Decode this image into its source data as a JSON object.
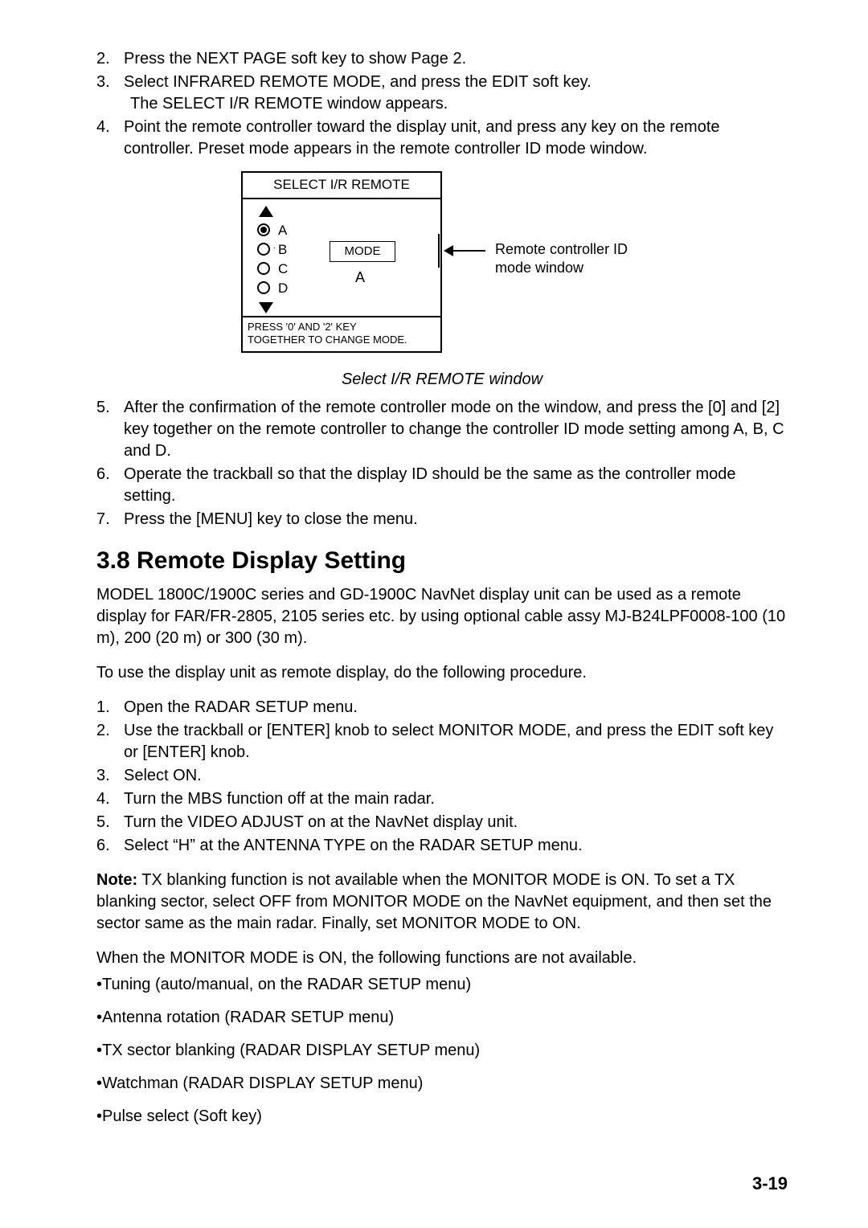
{
  "list1": {
    "i2": {
      "n": "2.",
      "t": "Press the NEXT PAGE soft key to show Page 2."
    },
    "i3": {
      "n": "3.",
      "t": "Select INFRARED REMOTE MODE, and press the EDIT soft key.",
      "sub": "The SELECT I/R REMOTE window appears."
    },
    "i4": {
      "n": "4.",
      "t": "Point the remote controller toward the display unit, and press any key on the remote controller. Preset mode appears in the remote controller ID mode window."
    }
  },
  "figure": {
    "title": "SELECT I/R REMOTE",
    "labels": {
      "A": "A",
      "B": "B",
      "C": "C",
      "D": "D"
    },
    "mode_label": "MODE",
    "mode_value": "A",
    "foot1": "PRESS '0' AND '2' KEY",
    "foot2": "TOGETHER TO CHANGE MODE.",
    "callout1": "Remote controller ID",
    "callout2": "mode window",
    "caption": "Select I/R REMOTE window"
  },
  "list2": {
    "i5": {
      "n": "5.",
      "t": "After the confirmation of the remote controller mode on the window, and press the [0] and [2] key together on the remote controller to change the controller ID mode setting among A, B, C and D."
    },
    "i6": {
      "n": "6.",
      "t": "Operate the trackball so that the display ID should be the same as the controller mode setting."
    },
    "i7": {
      "n": "7.",
      "t": "Press the [MENU] key to close the menu."
    }
  },
  "section_title": "3.8 Remote Display Setting",
  "para1": "MODEL 1800C/1900C series and GD-1900C NavNet display unit can be used as a remote display for FAR/FR-2805, 2105 series etc. by using optional cable assy MJ-B24LPF0008-100 (10 m), 200 (20 m) or 300 (30 m).",
  "para2": "To use the display unit as remote display, do the following procedure.",
  "list3": {
    "i1": {
      "n": "1.",
      "t": "Open the RADAR SETUP menu."
    },
    "i2": {
      "n": "2.",
      "t": "Use the trackball or [ENTER] knob to select MONITOR MODE, and press the EDIT soft key or [ENTER] knob."
    },
    "i3": {
      "n": "3.",
      "t": "Select ON."
    },
    "i4": {
      "n": "4.",
      "t": "Turn the MBS function off at the main radar."
    },
    "i5": {
      "n": "5.",
      "t": "Turn the VIDEO ADJUST on at the NavNet display unit."
    },
    "i6": {
      "n": "6.",
      "t": "Select “H” at the ANTENNA TYPE on the RADAR SETUP menu."
    }
  },
  "note_label": "Note:",
  "note_body": "    TX blanking function is not available when the MONITOR MODE is ON. To set a TX blanking sector, select OFF from MONITOR MODE on the NavNet equipment, and then set the sector same as the main radar. Finally, set MONITOR MODE to ON.",
  "para3": "When the MONITOR MODE is ON, the following functions are not available.",
  "bullets": {
    "b1": "•Tuning (auto/manual, on the RADAR SETUP menu)",
    "b2": "•Antenna rotation (RADAR SETUP menu)",
    "b3": "•TX sector blanking (RADAR DISPLAY SETUP menu)",
    "b4": "•Watchman (RADAR DISPLAY SETUP menu)",
    "b5": "•Pulse select (Soft key)"
  },
  "page_number": "3-19"
}
